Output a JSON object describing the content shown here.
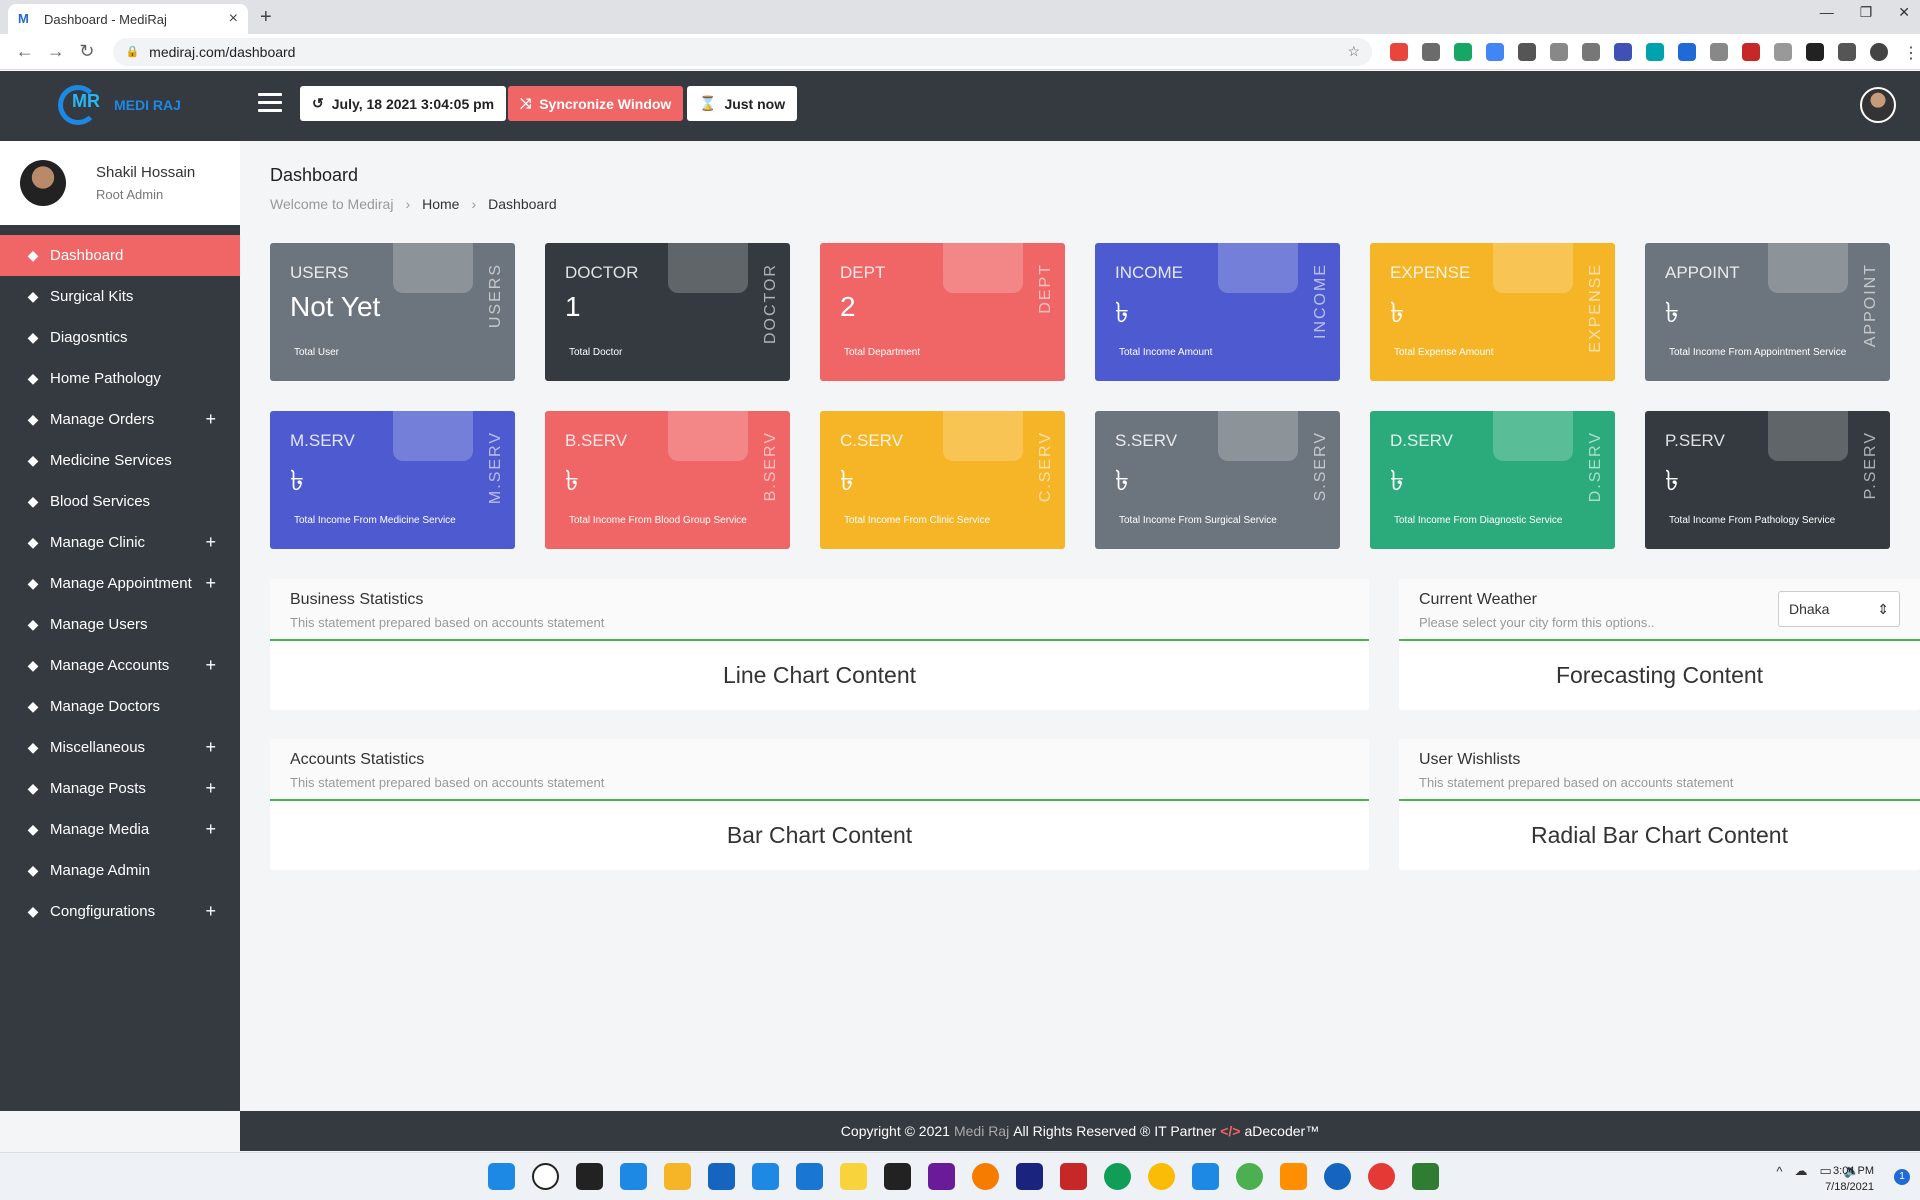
{
  "browser": {
    "tab_title": "Dashboard - MediRaj",
    "url": "mediraj.com/dashboard"
  },
  "brand": {
    "name": "MEDI RAJ"
  },
  "topbar": {
    "datetime": "July, 18 2021 3:04:05 pm",
    "sync_label": "Syncronize Window",
    "just_now": "Just now"
  },
  "profile": {
    "name": "Shakil Hossain",
    "role": "Root Admin"
  },
  "sidebar": {
    "items": [
      {
        "label": "Dashboard",
        "icon": "chart-line-icon",
        "plus": ""
      },
      {
        "label": "Surgical Kits",
        "icon": "briefcase-medical-icon",
        "plus": ""
      },
      {
        "label": "Diagosntics",
        "icon": "flask-icon",
        "plus": ""
      },
      {
        "label": "Home Pathology",
        "icon": "syringe-icon",
        "plus": ""
      },
      {
        "label": "Manage Orders",
        "icon": "cart-icon",
        "plus": "+"
      },
      {
        "label": "Medicine Services",
        "icon": "prescription-icon",
        "plus": ""
      },
      {
        "label": "Blood Services",
        "icon": "droplet-icon",
        "plus": ""
      },
      {
        "label": "Manage Clinic",
        "icon": "clinic-icon",
        "plus": "+"
      },
      {
        "label": "Manage Appointment",
        "icon": "calendar-icon",
        "plus": "+"
      },
      {
        "label": "Manage Users",
        "icon": "users-icon",
        "plus": ""
      },
      {
        "label": "Manage Accounts",
        "icon": "credit-card-icon",
        "plus": "+"
      },
      {
        "label": "Manage Doctors",
        "icon": "doctor-icon",
        "plus": ""
      },
      {
        "label": "Miscellaneous",
        "icon": "satellite-icon",
        "plus": "+"
      },
      {
        "label": "Manage Posts",
        "icon": "file-icon",
        "plus": "+"
      },
      {
        "label": "Manage Media",
        "icon": "media-icon",
        "plus": "+"
      },
      {
        "label": "Manage Admin",
        "icon": "admin-icon",
        "plus": ""
      },
      {
        "label": "Congfigurations",
        "icon": "cogs-icon",
        "plus": "+"
      }
    ]
  },
  "page": {
    "title": "Dashboard",
    "breadcrumb": [
      "Welcome to Mediraj",
      "Home",
      "Dashboard"
    ]
  },
  "cards": [
    {
      "label": "USERS",
      "value": "Not Yet",
      "sub": "Total User",
      "vert": "USERS",
      "color": "#6c757d"
    },
    {
      "label": "DOCTOR",
      "value": "1",
      "sub": "Total Doctor",
      "vert": "DOCTOR",
      "color": "#343a40"
    },
    {
      "label": "DEPT",
      "value": "2",
      "sub": "Total Department",
      "vert": "DEPT",
      "color": "#f06565"
    },
    {
      "label": "INCOME",
      "value": "৳",
      "sub": "Total Income Amount",
      "vert": "INCOME",
      "color": "#4e5bd0"
    },
    {
      "label": "EXPENSE",
      "value": "৳",
      "sub": "Total Expense Amount",
      "vert": "EXPENSE",
      "color": "#f6b526"
    },
    {
      "label": "APPOINT",
      "value": "৳",
      "sub": "Total Income From Appointment Service",
      "vert": "APPOINT",
      "color": "#6c757d"
    },
    {
      "label": "M.SERV",
      "value": "৳",
      "sub": "Total Income From Medicine Service",
      "vert": "M.SERV",
      "color": "#4e5bd0"
    },
    {
      "label": "B.SERV",
      "value": "৳",
      "sub": "Total Income From Blood Group Service",
      "vert": "B.SERV",
      "color": "#f06565"
    },
    {
      "label": "C.SERV",
      "value": "৳",
      "sub": "Total Income From Clinic Service",
      "vert": "C.SERV",
      "color": "#f6b526"
    },
    {
      "label": "S.SERV",
      "value": "৳",
      "sub": "Total Income From Surgical Service",
      "vert": "S.SERV",
      "color": "#6c757d"
    },
    {
      "label": "D.SERV",
      "value": "৳",
      "sub": "Total Income From Diagnostic Service",
      "vert": "D.SERV",
      "color": "#2bab7b"
    },
    {
      "label": "P.SERV",
      "value": "৳",
      "sub": "Total Income From Pathology Service",
      "vert": "P.SERV",
      "color": "#343a40"
    }
  ],
  "panels": {
    "business": {
      "title": "Business Statistics",
      "sub": "This statement prepared based on accounts statement",
      "body": "Line Chart Content"
    },
    "weather": {
      "title": "Current Weather",
      "sub": "Please select your city form this options..",
      "body": "Forecasting Content",
      "city": "Dhaka"
    },
    "accounts": {
      "title": "Accounts Statistics",
      "sub": "This statement prepared based on accounts statement",
      "body": "Bar Chart Content"
    },
    "wishlist": {
      "title": "User Wishlists",
      "sub": "This statement prepared based on accounts statement",
      "body": "Radial Bar Chart Content"
    }
  },
  "footer": {
    "copyright": "Copyright © 2021",
    "brand": "Medi Raj",
    "rights": "All Rights Reserved ® IT Partner",
    "partner": "aDecoder™"
  },
  "taskbar": {
    "time": "3:04 PM",
    "date": "7/18/2021",
    "notif": "1"
  }
}
